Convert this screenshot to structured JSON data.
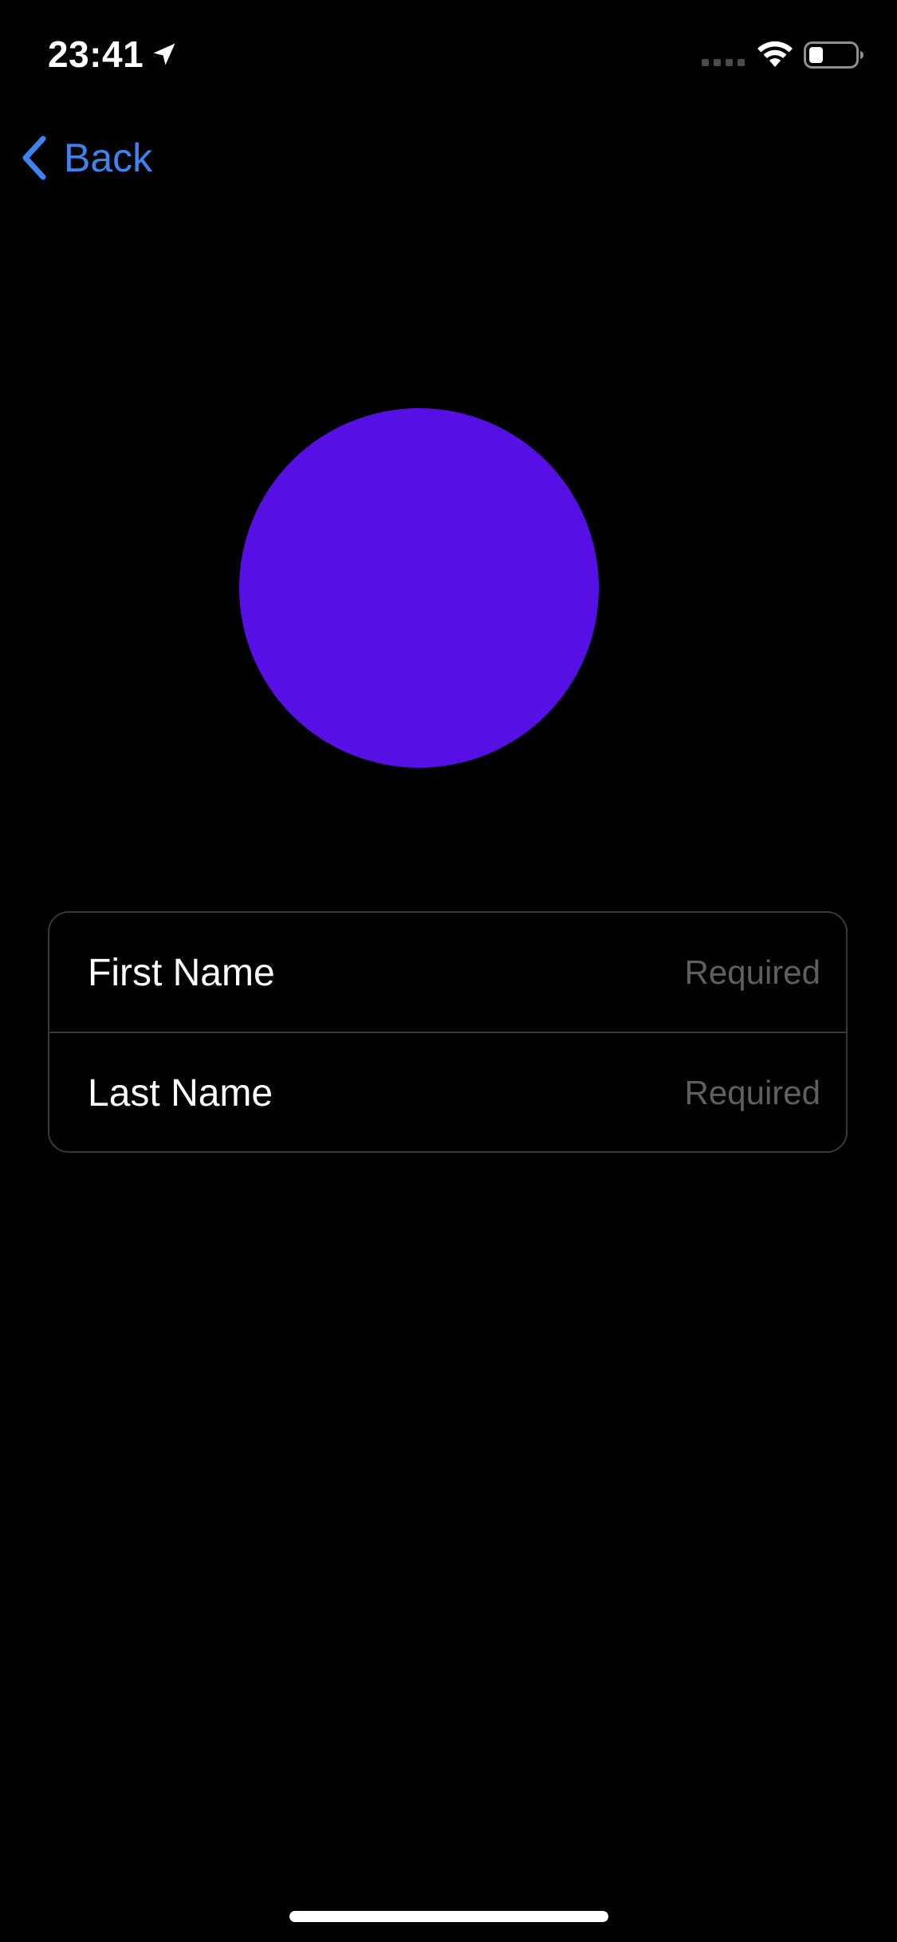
{
  "status_bar": {
    "time": "23:41",
    "icons": [
      "location-arrow-icon",
      "cellular-signal-icon",
      "wifi-icon",
      "battery-icon"
    ]
  },
  "nav": {
    "back_label": "Back",
    "back_icon": "chevron-left-icon"
  },
  "avatar": {
    "color": "#5710e4"
  },
  "form": {
    "fields": [
      {
        "label": "First Name",
        "placeholder": "Required",
        "value": ""
      },
      {
        "label": "Last Name",
        "placeholder": "Required",
        "value": ""
      }
    ]
  },
  "colors": {
    "background": "#000000",
    "accent": "#3d84f0",
    "avatar": "#5710e4",
    "placeholder": "#5f5f63",
    "separator": "#38383a"
  }
}
